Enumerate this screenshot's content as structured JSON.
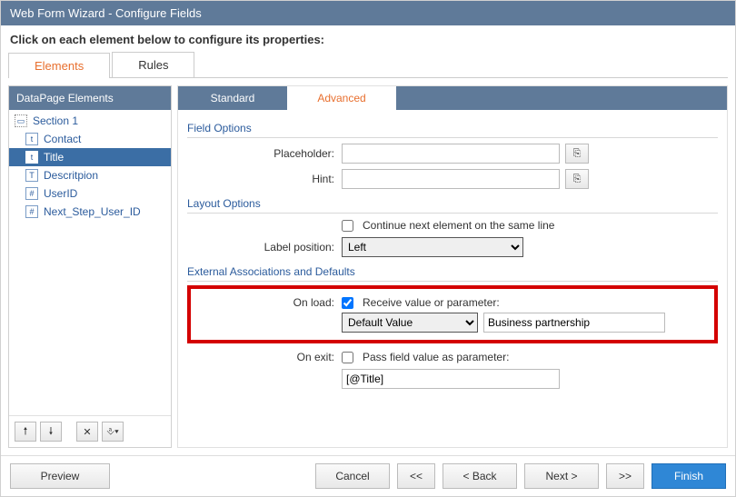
{
  "window": {
    "title": "Web Form Wizard - Configure Fields",
    "instruction": "Click on each element below to configure its properties:"
  },
  "topTabs": [
    "Elements",
    "Rules"
  ],
  "leftPanel": {
    "header": "DataPage Elements",
    "items": [
      {
        "label": "Section 1",
        "type": "section"
      },
      {
        "label": "Contact",
        "type": "text"
      },
      {
        "label": "Title",
        "type": "text",
        "selected": true
      },
      {
        "label": "Descritpion",
        "type": "textarea"
      },
      {
        "label": "UserID",
        "type": "number"
      },
      {
        "label": "Next_Step_User_ID",
        "type": "number"
      }
    ]
  },
  "rightTabs": [
    "Standard",
    "Advanced"
  ],
  "sections": {
    "fieldOptions": "Field Options",
    "layoutOptions": "Layout Options",
    "externalAssoc": "External Associations and Defaults"
  },
  "fields": {
    "placeholder": {
      "label": "Placeholder:",
      "value": ""
    },
    "hint": {
      "label": "Hint:",
      "value": ""
    },
    "continueSameLine": {
      "label": "Continue next element on the same line",
      "checked": false
    },
    "labelPosition": {
      "label": "Label position:",
      "value": "Left"
    },
    "onLoad": {
      "label": "On load:",
      "receiveLabel": "Receive value or parameter:",
      "receiveChecked": true,
      "sourceValue": "Default Value",
      "defaultValue": "Business partnership"
    },
    "onExit": {
      "label": "On exit:",
      "passLabel": "Pass field value as parameter:",
      "passChecked": false,
      "paramValue": "[@Title]"
    }
  },
  "footer": {
    "preview": "Preview",
    "cancel": "Cancel",
    "first": "<<",
    "back": "< Back",
    "next": "Next >",
    "last": ">>",
    "finish": "Finish"
  }
}
